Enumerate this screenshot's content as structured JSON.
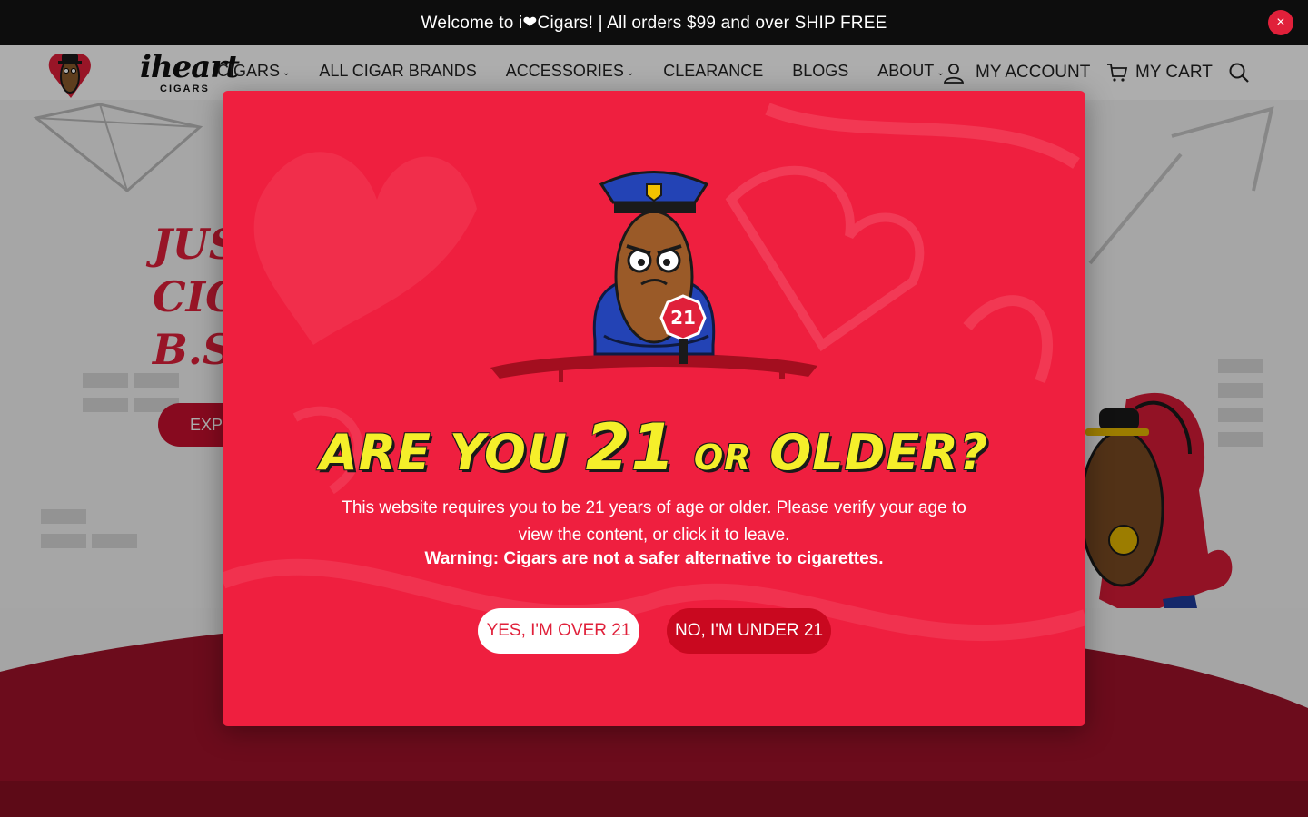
{
  "announcement": {
    "text": "Welcome to i❤Cigars! | All orders $99 and over SHIP FREE",
    "close_glyph": "×"
  },
  "header": {
    "logo_text": "iheart",
    "logo_sub": "CIGARS",
    "nav": [
      {
        "label": "CIGARS",
        "has_dropdown": true
      },
      {
        "label": "ALL CIGAR BRANDS",
        "has_dropdown": false
      },
      {
        "label": "ACCESSORIES",
        "has_dropdown": true
      },
      {
        "label": "CLEARANCE",
        "has_dropdown": false
      },
      {
        "label": "BLOGS",
        "has_dropdown": false
      },
      {
        "label": "ABOUT",
        "has_dropdown": true
      }
    ],
    "caret_glyph": "⌄",
    "account_label": "MY ACCOUNT",
    "cart_label": "MY CART"
  },
  "hero": {
    "headline_line1": "JUS",
    "headline_line2": "CIG",
    "headline_line3": "B.S",
    "button_label": "EXPL"
  },
  "modal": {
    "title_part1": "ARE YOU",
    "title_num": "21",
    "title_part2": "OR",
    "title_part3": "OLDER?",
    "body": "This website requires you to be 21 years of age or older. Please verify your age to view the content, or click it to leave.",
    "warning": "Warning: Cigars are not a safer alternative to cigarettes.",
    "yes_label": "YES, I'M OVER 21",
    "no_label": "NO, I'M UNDER 21",
    "stop_sign_text": "21"
  },
  "colors": {
    "brand_red": "#ef1f3f",
    "dark_red": "#c9081f",
    "title_yellow": "#f5ef2a",
    "announce_bg": "#0d0d0d"
  }
}
